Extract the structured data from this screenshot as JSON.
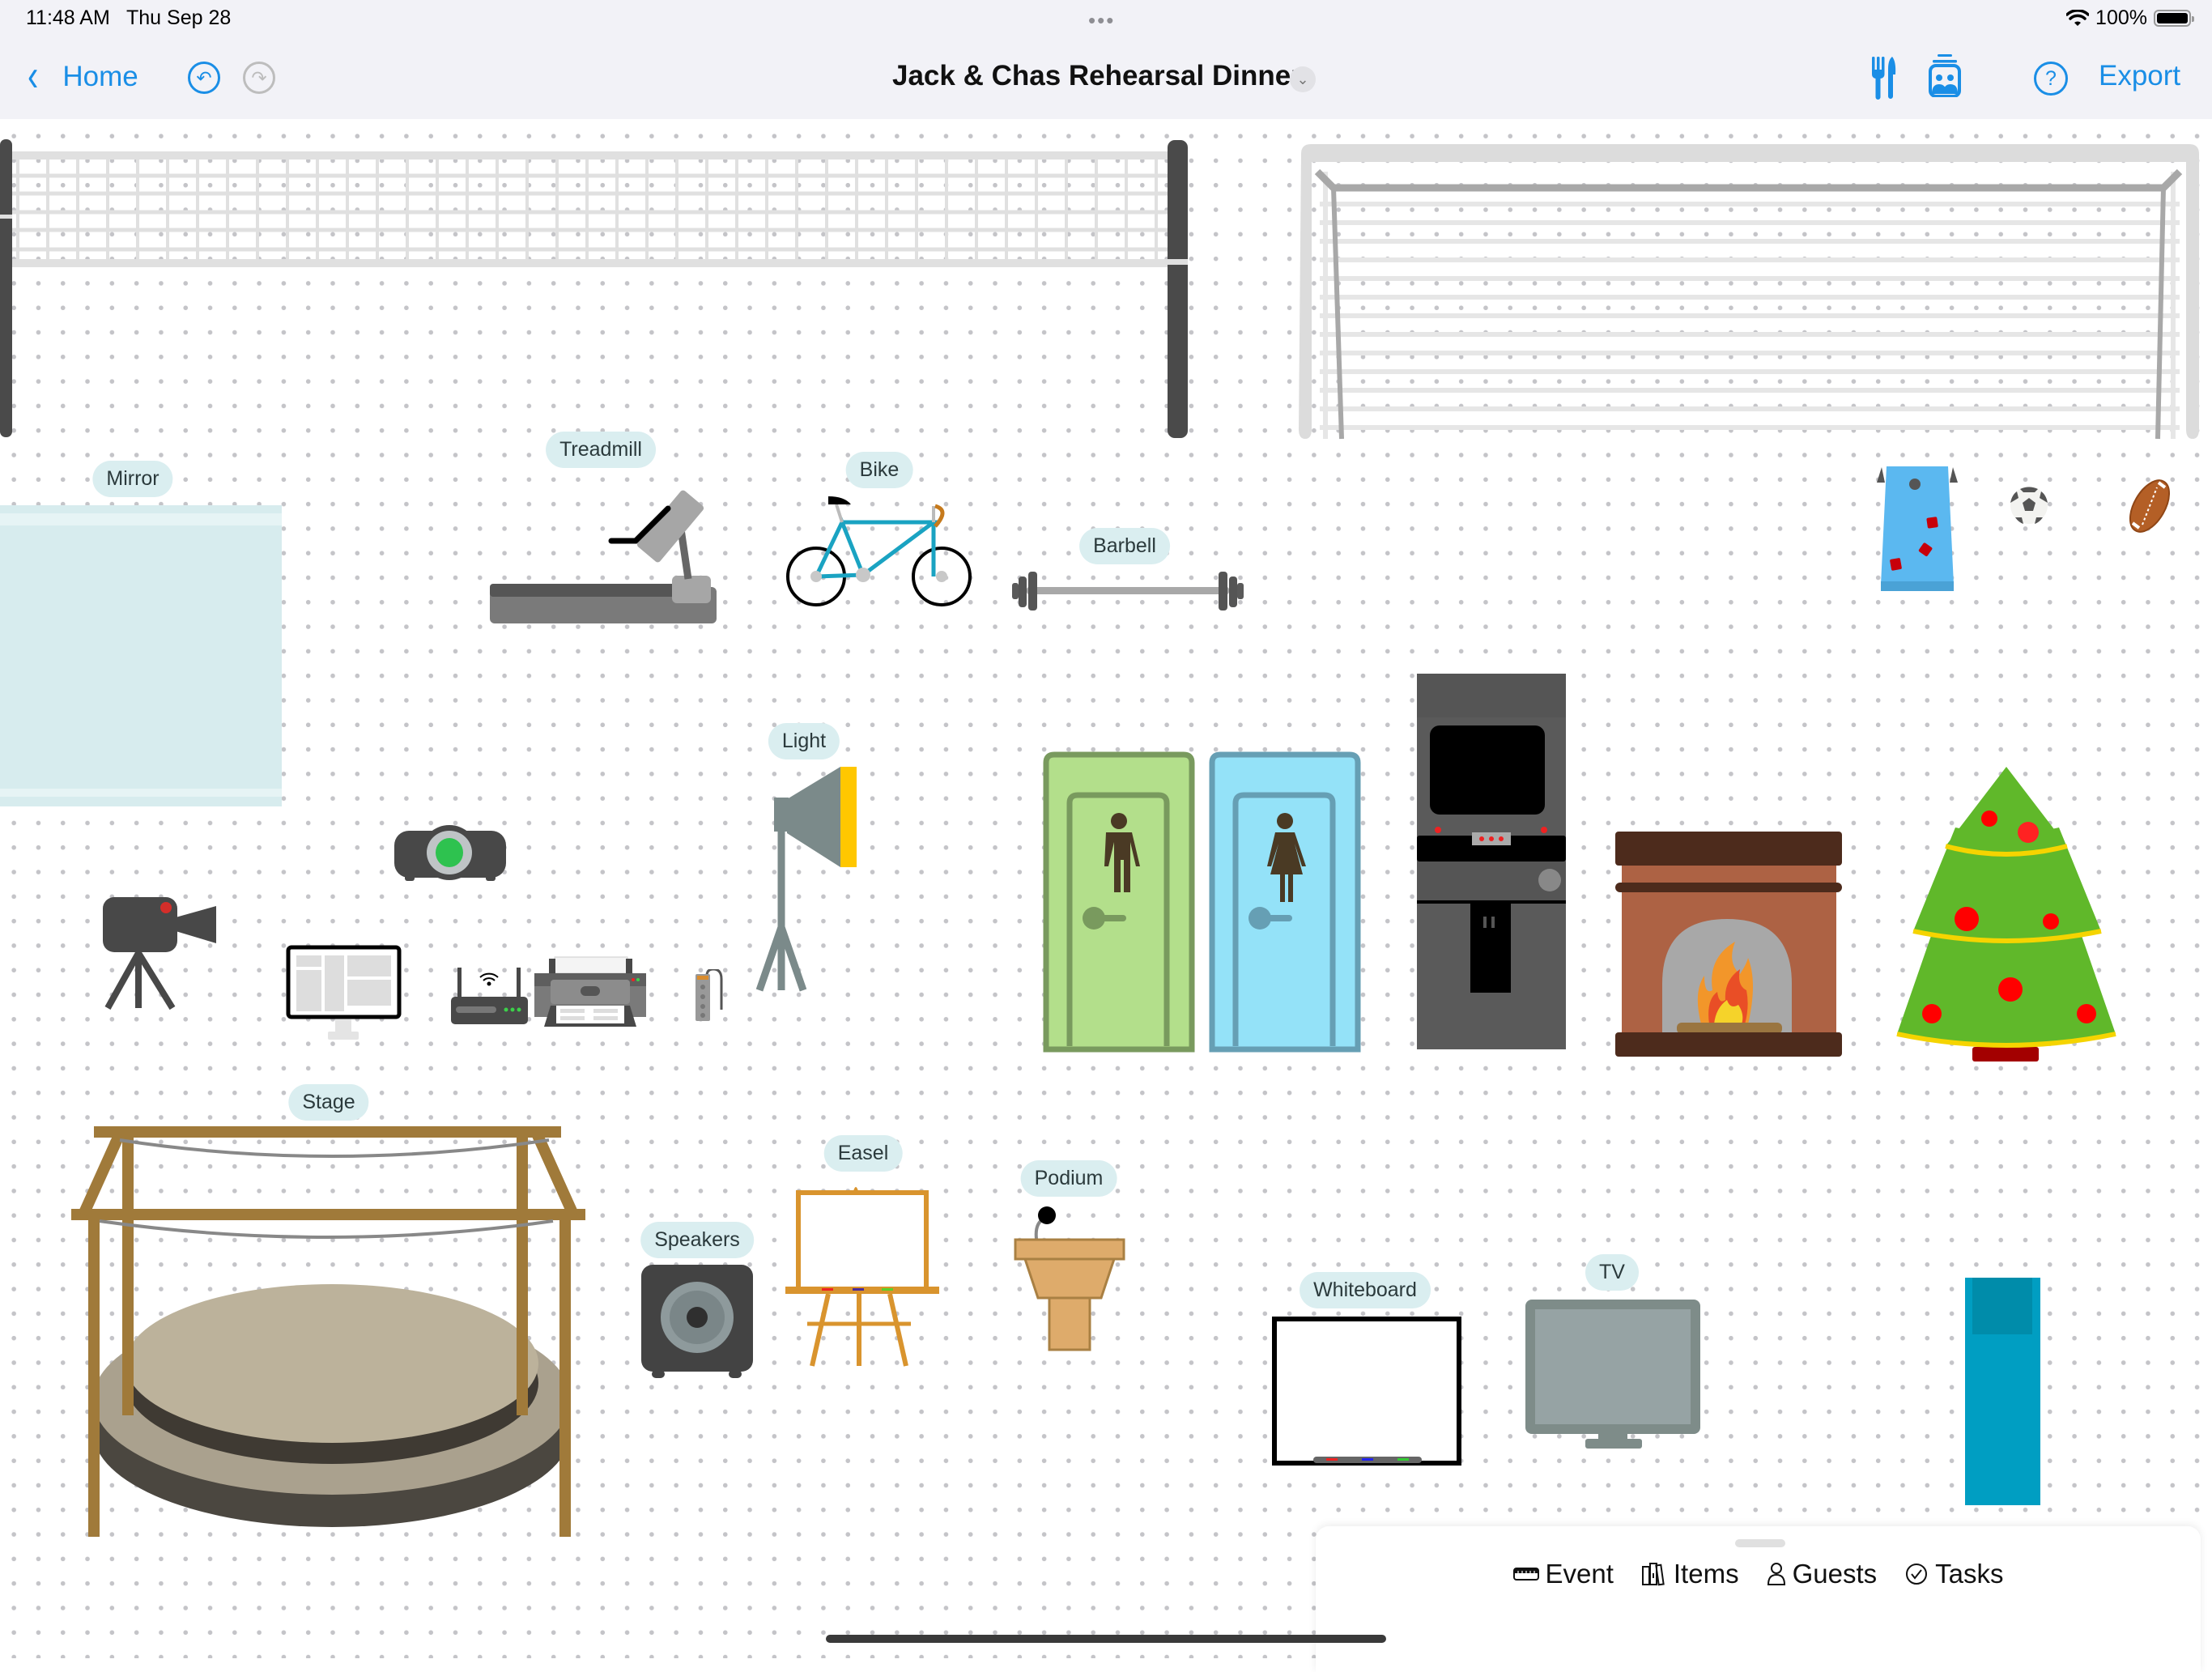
{
  "status_bar": {
    "time": "11:48 AM",
    "date": "Thu Sep 28",
    "multitask_dots": "•••",
    "battery": "100%",
    "wifi_icon": "wifi-icon"
  },
  "nav": {
    "back_label": "Home",
    "back_icon": "‹",
    "undo_icon": "↶",
    "redo_icon": "↷",
    "title": "Jack & Chas Rehearsal Dinner",
    "title_chevron": "⌄",
    "help_icon": "?",
    "export_label": "Export"
  },
  "colors": {
    "accent": "#1a8ee6",
    "label_bg": "#daeef0"
  },
  "canvas": {
    "items": [
      {
        "name": "Volleyball Net",
        "label": null
      },
      {
        "name": "Soccer Goal",
        "label": null
      },
      {
        "name": "Mirror",
        "label": "Mirror"
      },
      {
        "name": "Treadmill",
        "label": "Treadmill"
      },
      {
        "name": "Bike",
        "label": "Bike"
      },
      {
        "name": "Barbell",
        "label": "Barbell"
      },
      {
        "name": "Cornhole",
        "label": null
      },
      {
        "name": "Soccer Ball",
        "label": null
      },
      {
        "name": "Football",
        "label": null
      },
      {
        "name": "Light",
        "label": "Light"
      },
      {
        "name": "Projector",
        "label": null
      },
      {
        "name": "Video Camera",
        "label": null
      },
      {
        "name": "Monitor",
        "label": null
      },
      {
        "name": "Router",
        "label": null
      },
      {
        "name": "Printer",
        "label": null
      },
      {
        "name": "Power Strip",
        "label": null
      },
      {
        "name": "Men's Restroom",
        "label": null
      },
      {
        "name": "Women's Restroom",
        "label": null
      },
      {
        "name": "Arcade Machine",
        "label": null
      },
      {
        "name": "Fireplace",
        "label": null
      },
      {
        "name": "Christmas Tree",
        "label": null
      },
      {
        "name": "Stage",
        "label": "Stage"
      },
      {
        "name": "Speakers",
        "label": "Speakers"
      },
      {
        "name": "Easel",
        "label": "Easel"
      },
      {
        "name": "Podium",
        "label": "Podium"
      },
      {
        "name": "Whiteboard",
        "label": "Whiteboard"
      },
      {
        "name": "TV",
        "label": "TV"
      },
      {
        "name": "Blue Panel",
        "label": null
      }
    ]
  },
  "bottom_sheet": {
    "tabs": [
      {
        "label": "Event",
        "icon": "ruler-icon"
      },
      {
        "label": "Items",
        "icon": "books-icon"
      },
      {
        "label": "Guests",
        "icon": "person-icon"
      },
      {
        "label": "Tasks",
        "icon": "checkmark-circle-icon"
      }
    ]
  }
}
